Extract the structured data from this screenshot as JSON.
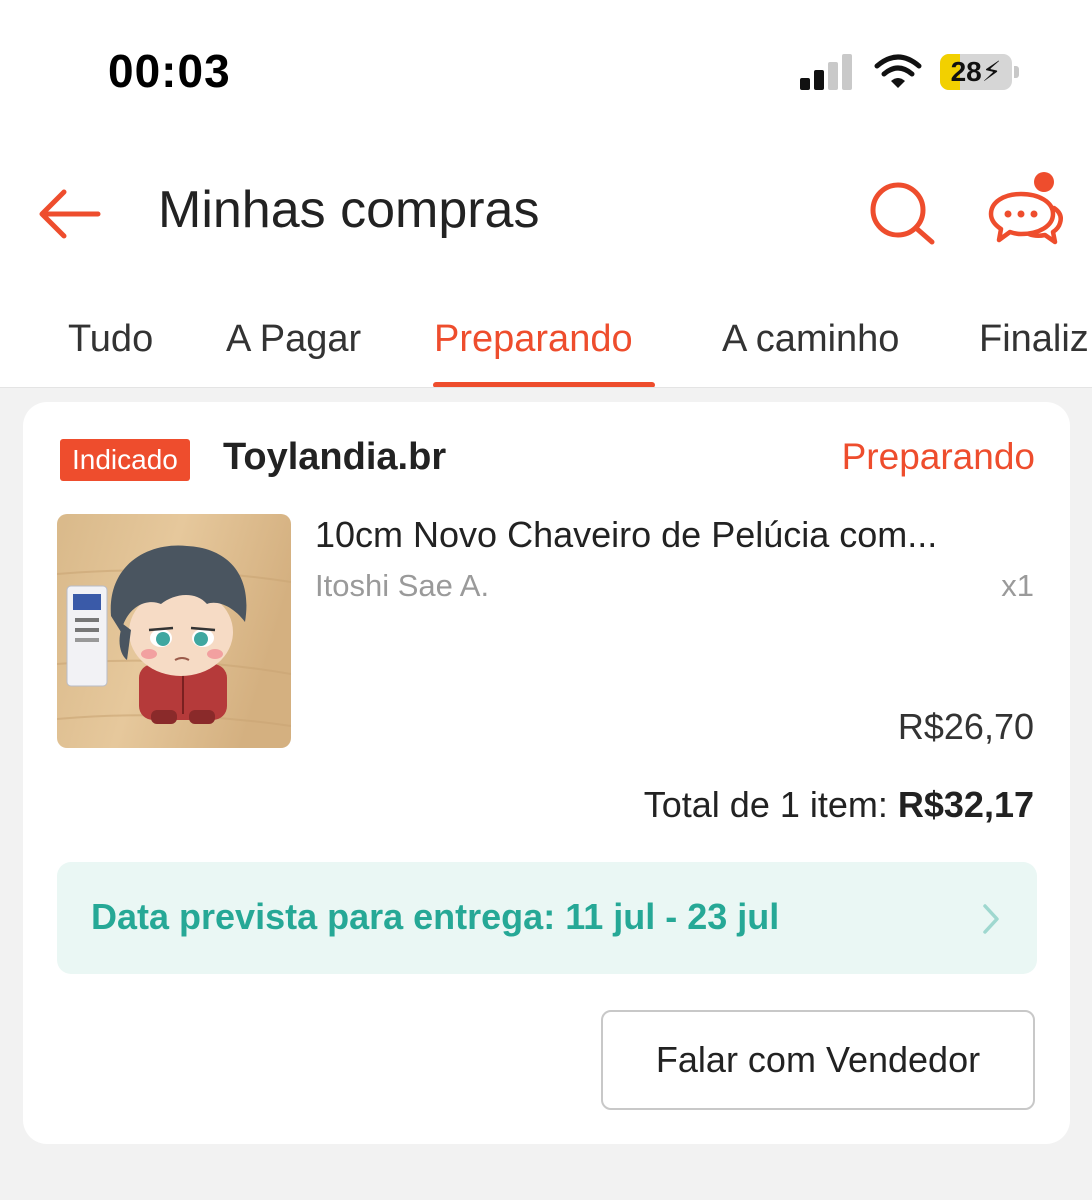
{
  "status_bar": {
    "time": "00:03",
    "battery_level": "28",
    "battery_percent": 28
  },
  "header": {
    "title": "Minhas compras",
    "back_icon": "arrow-left-icon",
    "search_icon": "search-icon",
    "chat_icon": "chat-bubbles-icon",
    "has_notification": true
  },
  "tabs": [
    {
      "label": "Tudo",
      "active": false
    },
    {
      "label": "A Pagar",
      "active": false
    },
    {
      "label": "Preparando",
      "active": true
    },
    {
      "label": "A caminho",
      "active": false
    },
    {
      "label": "Finaliz",
      "active": false
    }
  ],
  "order": {
    "badge": "Indicado",
    "shop_name": "Toylandia.br",
    "status": "Preparando",
    "product": {
      "name": "10cm Novo Chaveiro de Pelúcia com...",
      "variant": "Itoshi Sae A.",
      "quantity": "x1",
      "price": "R$26,70"
    },
    "total_label": "Total de 1 item: ",
    "total_value": "R$32,17",
    "delivery": "Data prevista para entrega: 11 jul - 23 jul",
    "seller_button": "Falar com Vendedor"
  },
  "colors": {
    "accent": "#ee4d2d",
    "delivery_text": "#26a896",
    "delivery_bg": "#eaf7f4",
    "page_bg": "#f2f2f2"
  }
}
